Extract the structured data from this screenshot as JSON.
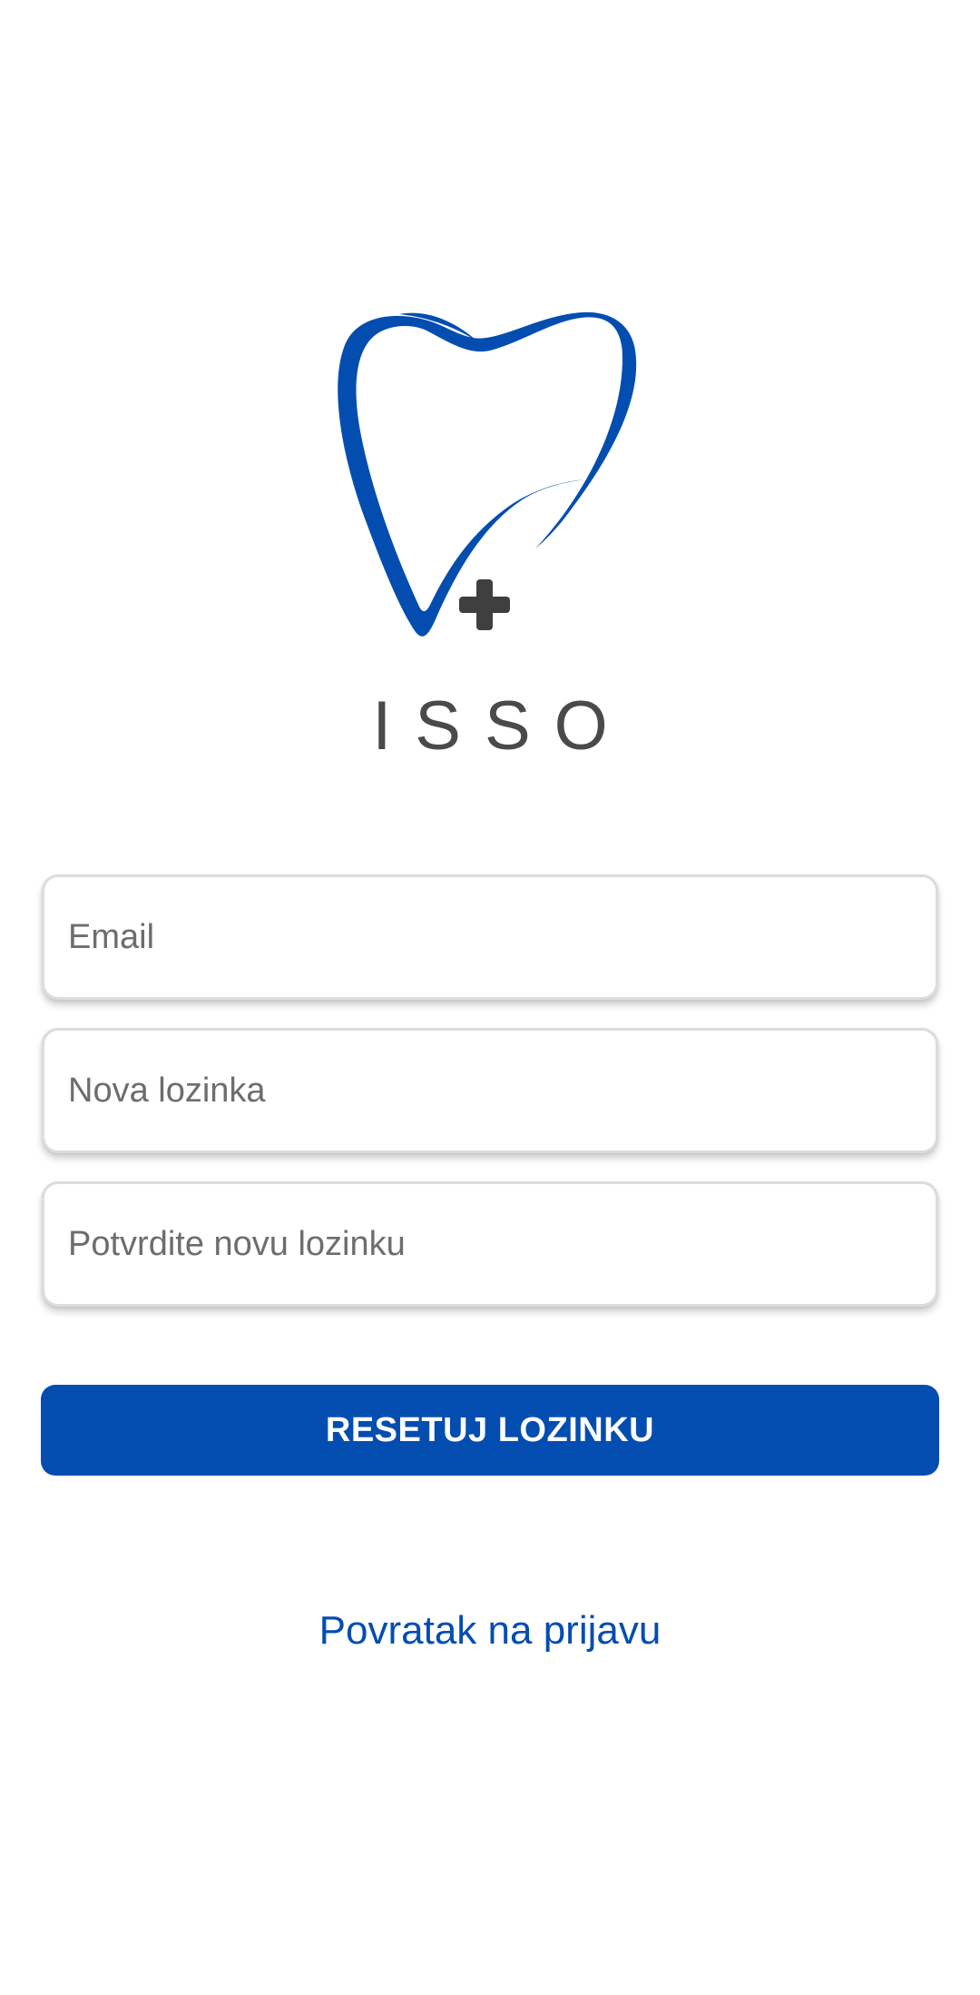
{
  "app": {
    "brand_name": "ISSO",
    "logo_icon": "tooth-plus-logo-icon",
    "colors": {
      "primary": "#034db1",
      "logo_dark": "#3f3f3f",
      "text_gray": "#4a4a4a",
      "placeholder": "#6d6d6d",
      "background": "#ffffff"
    }
  },
  "form": {
    "email_placeholder": "Email",
    "new_password_placeholder": "Nova lozinka",
    "confirm_password_placeholder": "Potvrdite novu lozinku",
    "submit_label": "RESETUJ LOZINKU",
    "back_link_label": "Povratak na prijavu"
  }
}
